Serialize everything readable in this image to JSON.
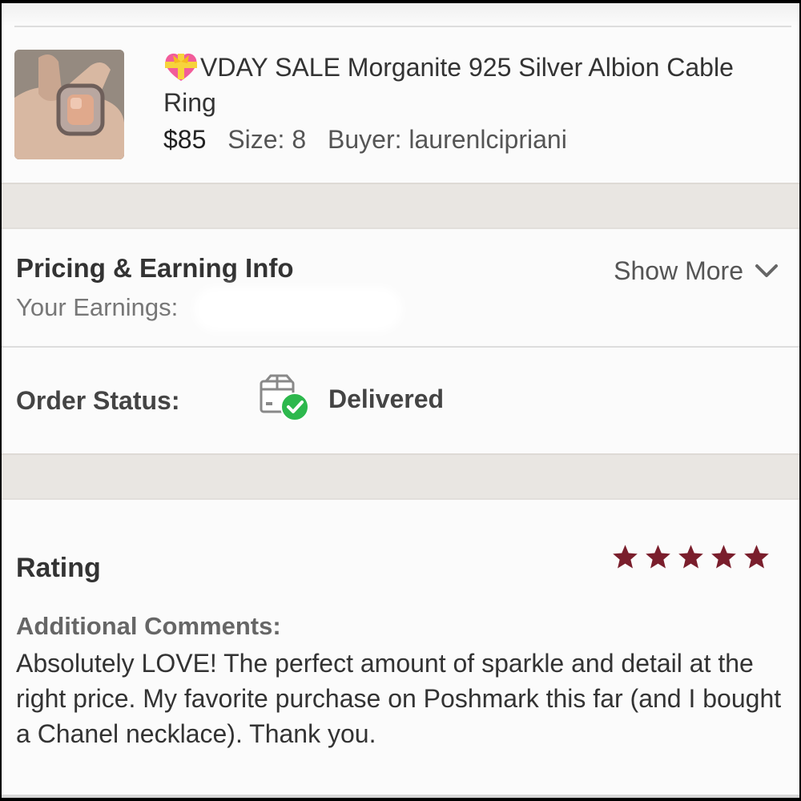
{
  "listing": {
    "emoji_icon": "heart-with-ribbon-icon",
    "title": "VDAY SALE Morganite 925 Silver Albion Cable Ring",
    "price": "$85",
    "size": "Size: 8",
    "buyer": "Buyer: laurenlcipriani"
  },
  "pricing": {
    "title": "Pricing & Earning Info",
    "show_more": "Show More",
    "earnings_label": "Your Earnings:"
  },
  "order": {
    "label": "Order Status:",
    "value": "Delivered",
    "icon": "package-delivered-icon",
    "check_color": "#2db84d"
  },
  "rating": {
    "label": "Rating",
    "stars": 5,
    "star_color": "#7a1e2c",
    "comments_label": "Additional Comments:",
    "comments": "Absolutely LOVE! The perfect amount of sparkle and detail at the right price. My favorite purchase on Poshmark this far (and I bought a Chanel necklace). Thank you."
  }
}
